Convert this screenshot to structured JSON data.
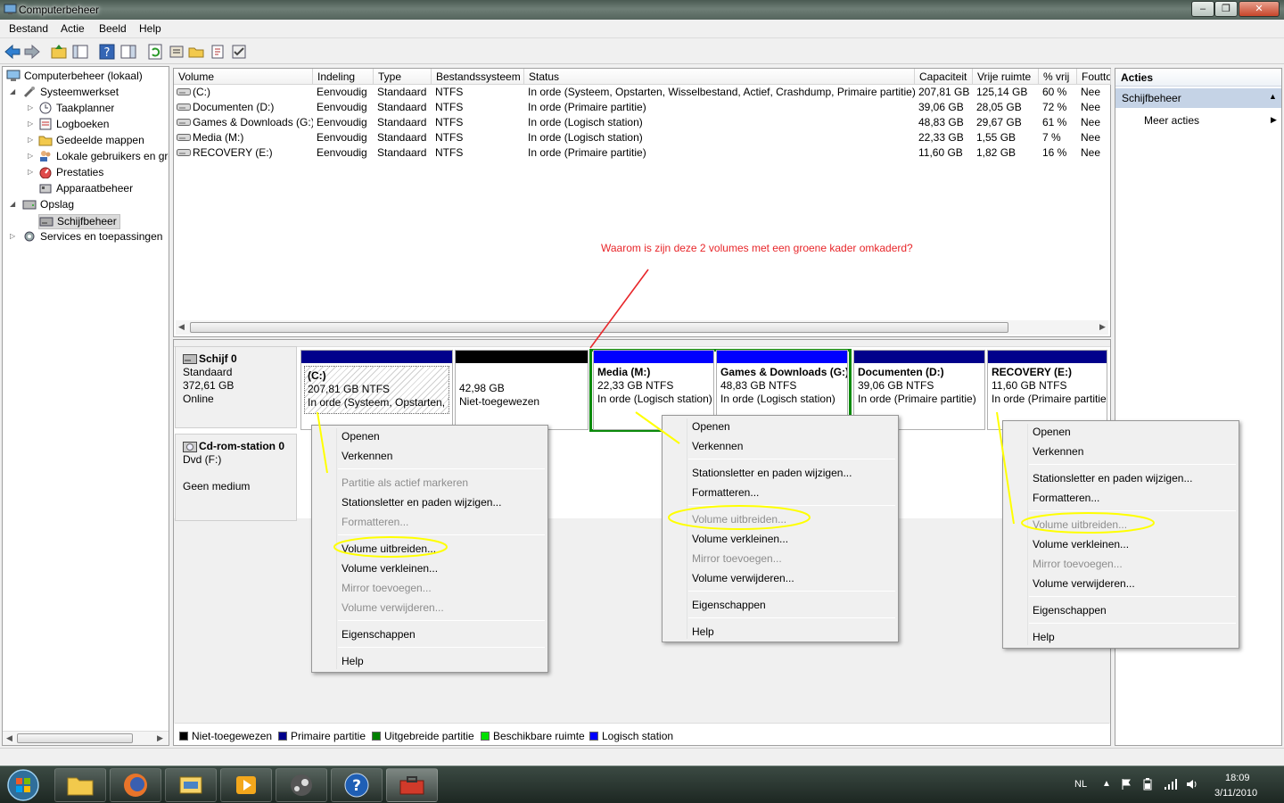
{
  "window": {
    "title": "Computerbeheer"
  },
  "menubar": {
    "items": [
      "Bestand",
      "Actie",
      "Beeld",
      "Help"
    ]
  },
  "tree": {
    "items": [
      {
        "label": "Computerbeheer (lokaal)",
        "icon": "computer-icon"
      },
      {
        "label": "Systeemwerkset",
        "icon": "tools-icon"
      },
      {
        "label": "Taakplanner",
        "icon": "clock-icon"
      },
      {
        "label": "Logboeken",
        "icon": "event-viewer-icon"
      },
      {
        "label": "Gedeelde mappen",
        "icon": "shared-folder-icon"
      },
      {
        "label": "Lokale gebruikers en groepen",
        "icon": "users-icon"
      },
      {
        "label": "Prestaties",
        "icon": "performance-icon"
      },
      {
        "label": "Apparaatbeheer",
        "icon": "device-manager-icon"
      },
      {
        "label": "Opslag",
        "icon": "storage-icon"
      },
      {
        "label": "Schijfbeheer",
        "icon": "disk-icon"
      },
      {
        "label": "Services en toepassingen",
        "icon": "services-icon"
      }
    ]
  },
  "volumes": {
    "columns": [
      "Volume",
      "Indeling",
      "Type",
      "Bestandssysteem",
      "Status",
      "Capaciteit",
      "Vrije ruimte",
      "% vrij",
      "Foutto"
    ],
    "rows": [
      [
        "(C:)",
        "Eenvoudig",
        "Standaard",
        "NTFS",
        "In orde (Systeem, Opstarten, Wisselbestand, Actief, Crashdump, Primaire partitie)",
        "207,81 GB",
        "125,14 GB",
        "60 %",
        "Nee"
      ],
      [
        "Documenten (D:)",
        "Eenvoudig",
        "Standaard",
        "NTFS",
        "In orde (Primaire partitie)",
        "39,06 GB",
        "28,05 GB",
        "72 %",
        "Nee"
      ],
      [
        "Games & Downloads (G:)",
        "Eenvoudig",
        "Standaard",
        "NTFS",
        "In orde (Logisch station)",
        "48,83 GB",
        "29,67 GB",
        "61 %",
        "Nee"
      ],
      [
        "Media (M:)",
        "Eenvoudig",
        "Standaard",
        "NTFS",
        "In orde (Logisch station)",
        "22,33 GB",
        "1,55 GB",
        "7 %",
        "Nee"
      ],
      [
        "RECOVERY (E:)",
        "Eenvoudig",
        "Standaard",
        "NTFS",
        "In orde (Primaire partitie)",
        "11,60 GB",
        "1,82 GB",
        "16 %",
        "Nee"
      ]
    ]
  },
  "annotation": {
    "text": "Waarom is zijn deze 2 volumes met een groene kader omkaderd?",
    "color": "#e8262a"
  },
  "disks": {
    "disk0": {
      "name": "Schijf 0",
      "kind": "Standaard",
      "size": "372,61 GB",
      "state": "Online"
    },
    "cdrom": {
      "name": "Cd-rom-station 0",
      "kind": "Dvd (F:)",
      "state": "Geen medium"
    }
  },
  "partitions": [
    {
      "title": "(C:)",
      "size": "207,81 GB NTFS",
      "status": "In orde (Systeem, Opstarten, Wisselbestand, Actief, Crashdump, Primaire partitie)",
      "bar": "#00008b"
    },
    {
      "title": "",
      "size": "42,98 GB",
      "status": "Niet-toegewezen",
      "bar": "#000000"
    },
    {
      "title": "Media  (M:)",
      "size": "22,33 GB NTFS",
      "status": "In orde (Logisch station)",
      "bar": "#0000ff"
    },
    {
      "title": "Games & Downloads  (G:)",
      "size": "48,83 GB NTFS",
      "status": "In orde (Logisch station)",
      "bar": "#0000ff"
    },
    {
      "title": "Documenten  (D:)",
      "size": "39,06 GB NTFS",
      "status": "In orde (Primaire partitie)",
      "bar": "#00008b"
    },
    {
      "title": "RECOVERY  (E:)",
      "size": "11,60 GB NTFS",
      "status": "In orde (Primaire partitie)",
      "bar": "#00008b"
    }
  ],
  "legend": [
    {
      "label": "Niet-toegewezen",
      "color": "#000000"
    },
    {
      "label": "Primaire partitie",
      "color": "#00008b"
    },
    {
      "label": "Uitgebreide partitie",
      "color": "#008000"
    },
    {
      "label": "Beschikbare ruimte",
      "color": "#00e000"
    },
    {
      "label": "Logisch station",
      "color": "#0000ff"
    }
  ],
  "actions": {
    "header": "Acties",
    "section": "Schijfbeheer",
    "more": "Meer acties"
  },
  "ctx1": [
    "Openen",
    "Verkennen",
    "Partitie als actief markeren",
    "Stationsletter en paden wijzigen...",
    "Formatteren...",
    "Volume uitbreiden...",
    "Volume verkleinen...",
    "Mirror toevoegen...",
    "Volume verwijderen...",
    "Eigenschappen",
    "Help"
  ],
  "ctx2": [
    "Openen",
    "Verkennen",
    "Stationsletter en paden wijzigen...",
    "Formatteren...",
    "Volume uitbreiden...",
    "Volume verkleinen...",
    "Mirror toevoegen...",
    "Volume verwijderen...",
    "Eigenschappen",
    "Help"
  ],
  "ctx3": [
    "Openen",
    "Verkennen",
    "Stationsletter en paden wijzigen...",
    "Formatteren...",
    "Volume uitbreiden...",
    "Volume verkleinen...",
    "Mirror toevoegen...",
    "Volume verwijderen...",
    "Eigenschappen",
    "Help"
  ],
  "tray": {
    "lang": "NL",
    "time": "18:09",
    "date": "3/11/2010"
  },
  "colors": {
    "highlight_ring": "#ffff00",
    "selection_frame": "#0a8a0a",
    "action_header": "#c5d3e6"
  }
}
